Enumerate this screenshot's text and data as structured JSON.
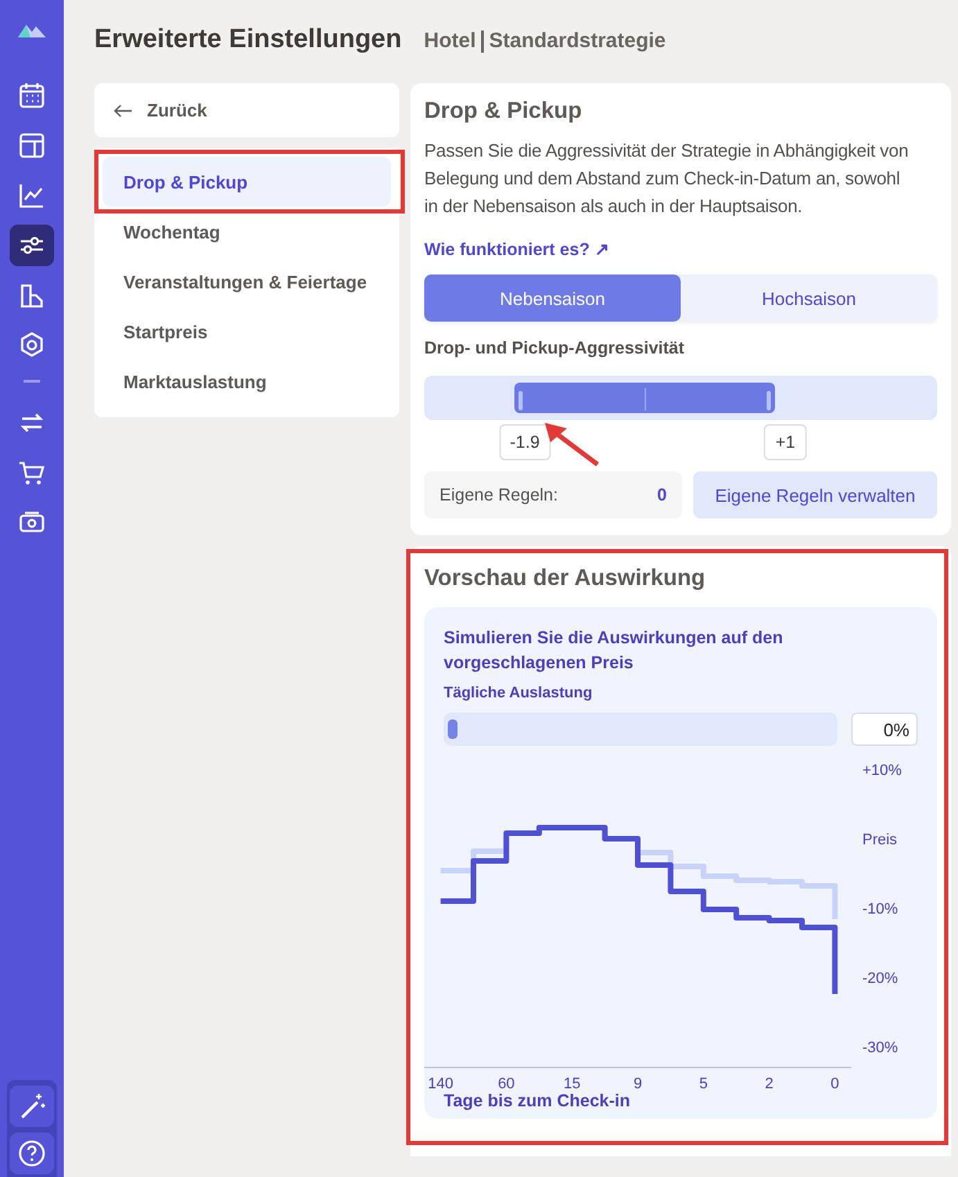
{
  "sidebar": {
    "items": [
      {
        "kind": "logo",
        "selected": false
      },
      {
        "kind": "calendar",
        "selected": false
      },
      {
        "kind": "layout",
        "selected": false
      },
      {
        "kind": "chart",
        "selected": false
      },
      {
        "kind": "sliders",
        "selected": true
      },
      {
        "kind": "building",
        "selected": false
      },
      {
        "kind": "gear",
        "selected": false
      },
      {
        "kind": "divider",
        "selected": false
      },
      {
        "kind": "swap",
        "selected": false
      },
      {
        "kind": "cart",
        "selected": false
      },
      {
        "kind": "camera",
        "selected": false
      }
    ],
    "bottom_items": [
      {
        "kind": "wand"
      },
      {
        "kind": "help"
      }
    ]
  },
  "header": {
    "title": "Erweiterte Einstellungen",
    "subtitle_left": "Hotel",
    "subtitle_right": "Standardstrategie"
  },
  "nav": {
    "back": "Zurück",
    "items": [
      {
        "label": "Drop & Pickup",
        "selected": true,
        "highlighted": true
      },
      {
        "label": "Wochentag",
        "selected": false,
        "highlighted": false
      },
      {
        "label": "Veranstaltungen & Feiertage",
        "selected": false,
        "highlighted": false
      },
      {
        "label": "Startpreis",
        "selected": false,
        "highlighted": false
      },
      {
        "label": "Marktauslastung",
        "selected": false,
        "highlighted": false
      }
    ]
  },
  "drop_pickup": {
    "title": "Drop & Pickup",
    "description": "Passen Sie die Aggressivität der Strategie in Abhängigkeit von Belegung und dem Abstand zum Check-in-Datum an, sowohl in der Nebensaison als auch in der Hauptsaison.",
    "link": "Wie funktioniert es? ↗",
    "seasons": [
      {
        "label": "Nebensaison",
        "selected": true
      },
      {
        "label": "Hochsaison",
        "selected": false
      }
    ],
    "slider_label": "Drop- und Pickup-Aggressivität",
    "handles": [
      {
        "value": "-1.9",
        "level": 0.176,
        "pointed_at": true
      },
      {
        "value": "+1",
        "level": 0.684,
        "pointed_at": false
      }
    ],
    "own_rules_label": "Eigene Regeln:",
    "own_rules_count": "0",
    "manage_button": "Eigene Regeln verwalten"
  },
  "preview": {
    "title": "Vorschau der Auswirkung",
    "highlighted": true,
    "simulate_title": "Simulieren Sie die Auswirkungen auf den vorgeschlagenen Preis",
    "occupancy_label": "Tägliche Auslastung",
    "occupancy": {
      "level": 0,
      "value": "0%"
    },
    "chart": {
      "x_title": "Tage bis zum Check-in",
      "x_labels": [
        "140",
        "60",
        "15",
        "9",
        "5",
        "2",
        "0"
      ],
      "y_labels": [
        "+10%",
        "Preis",
        "-10%",
        "-20%",
        "-30%"
      ]
    }
  }
}
